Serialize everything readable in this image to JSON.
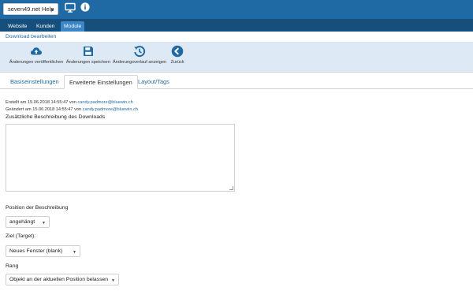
{
  "topbar": {
    "site_select": "seven49.net Help",
    "icons": [
      "monitor-icon",
      "info-icon"
    ],
    "bg_color": "#1f6aa5"
  },
  "nav": {
    "tabs": [
      "Website",
      "Kunden",
      "Module"
    ],
    "active_tab": "Module"
  },
  "breadcrumb": "Download bearbeiten",
  "toolbar": {
    "publish_label": "Änderungen veröffentlichen",
    "save_label": "Änderungen speichern",
    "history_label": "Änderungsverlauf anzeigen",
    "back_label": "Zurück",
    "icon_color": "#1f6aa5"
  },
  "tabs": {
    "items": [
      "Basiseinstellungen",
      "Erweiterte Einstellungen",
      "Layout/Tags"
    ],
    "active": "Erweiterte Einstellungen"
  },
  "meta": {
    "created_prefix": "Erstellt am 15.06.2018 14:55:47 von",
    "created_by": "candy.padmore@bluewin.ch",
    "changed_prefix": "Geändert am 15.06.2018 14:55:47 von",
    "changed_by": "candy.padmore@bluewin.ch"
  },
  "form": {
    "description_label": "Zusätzliche Beschreibung des Downloads",
    "description_value": "",
    "position_label": "Position der Beschreibung",
    "position_value": "angehängt",
    "target_label": "Ziel (Target):",
    "target_value": "Neues Fenster (blank)",
    "rank_label": "Rang",
    "rank_value": "Objekt an der aktuellen Position belassen"
  }
}
